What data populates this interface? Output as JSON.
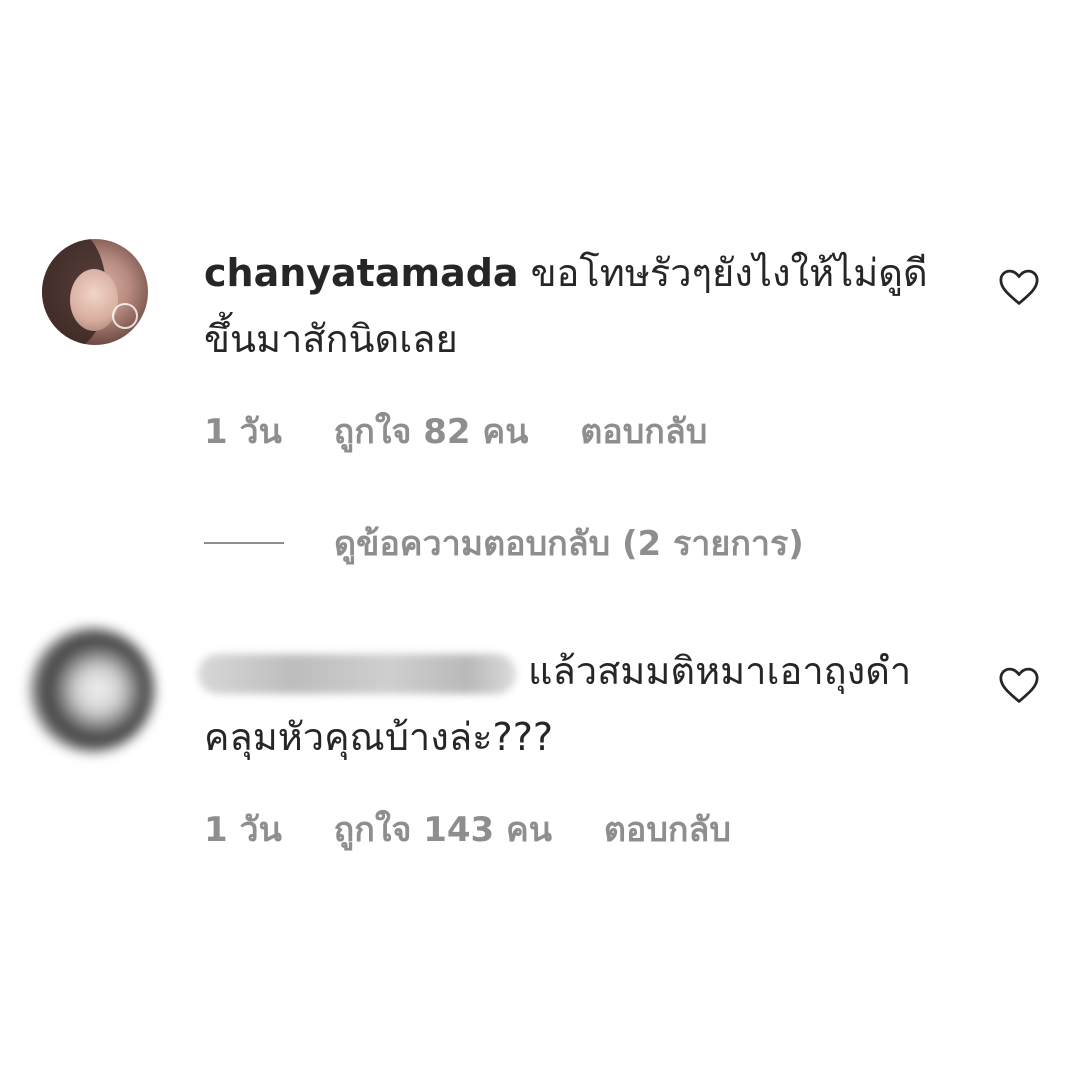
{
  "comments": [
    {
      "username": "chanyatamada",
      "text": "ขอโทษรัวๆยังไงให้ไม่ดูดีขึ้นมาสักนิดเลย",
      "time": "1 วัน",
      "likes": "ถูกใจ 82 คน",
      "reply_label": "ตอบกลับ",
      "view_replies_label": "ดูข้อความตอบกลับ (2 รายการ)",
      "icons": {
        "like": "heart-outline-icon"
      }
    },
    {
      "username": "",
      "text": "แล้วสมมติหมาเอาถุงดำคลุมหัวคุณบ้างล่ะ???",
      "time": "1 วัน",
      "likes": "ถูกใจ 143 คน",
      "reply_label": "ตอบกลับ",
      "icons": {
        "like": "heart-outline-icon"
      }
    }
  ],
  "colors": {
    "text_primary": "#262626",
    "text_secondary": "#8e8e8e",
    "background": "#ffffff"
  }
}
